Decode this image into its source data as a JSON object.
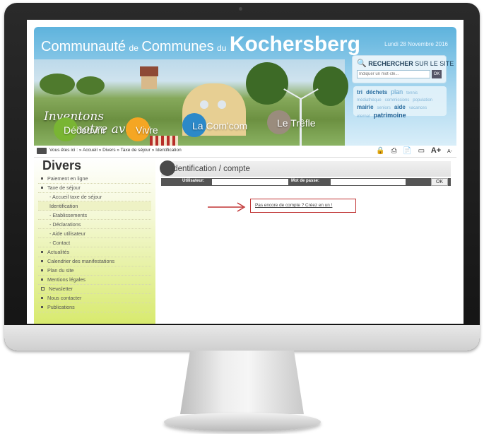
{
  "header": {
    "brand": {
      "part1": "Communauté",
      "de": "de",
      "part2": "Communes",
      "du": "du",
      "name": "Kochersberg"
    },
    "date": "Lundi 28 Novembre 2016",
    "slogan": {
      "line1": "Inventons",
      "line2": "notre avenir"
    },
    "search": {
      "title": "RECHERCHER",
      "subtitle": "SUR LE SITE",
      "placeholder": "Indiquer un mot-clé...",
      "ok": "OK"
    },
    "tags": [
      "tri",
      "déchets",
      "plan",
      "tennis",
      "médiathèque",
      "commissions",
      "population",
      "mairie",
      "seniors",
      "aide",
      "vacances",
      "eternat",
      "patrimoine"
    ],
    "nav": [
      {
        "label": "Découvrir",
        "color": "#79b533"
      },
      {
        "label": "Vivre",
        "color": "#f5a623"
      },
      {
        "label": "La Com'com",
        "color": "#2c89c9"
      },
      {
        "label": "Le Trêfle",
        "color": "#9a8c7d"
      }
    ]
  },
  "breadcrumb": "Vous êtes ici : » Accueil » Divers » Taxe de séjour » Identification",
  "tools": [
    "lock-icon",
    "print-icon",
    "pdf-icon",
    "window-icon",
    "A+",
    "A-"
  ],
  "sidebar": {
    "title": "Divers",
    "items": [
      {
        "label": "Paiement en ligne",
        "type": "bullet"
      },
      {
        "label": "Taxe de séjour",
        "type": "bullet"
      },
      {
        "label": "- Accueil taxe de séjour",
        "type": "sub"
      },
      {
        "label": "Identification",
        "type": "sub-active"
      },
      {
        "label": "- Etablissements",
        "type": "sub"
      },
      {
        "label": "- Déclarations",
        "type": "sub"
      },
      {
        "label": "- Aide utilisateur",
        "type": "sub"
      },
      {
        "label": "- Contact",
        "type": "sub"
      },
      {
        "label": "Actualités",
        "type": "bullet"
      },
      {
        "label": "Calendrier des manifestations",
        "type": "bullet"
      },
      {
        "label": "Plan du site",
        "type": "bullet"
      },
      {
        "label": "Mentions légales",
        "type": "bullet"
      },
      {
        "label": "Newsletter",
        "type": "square"
      },
      {
        "label": "Nous contacter",
        "type": "bullet"
      },
      {
        "label": "Publications",
        "type": "bullet"
      }
    ]
  },
  "main": {
    "title": "Identification / compte",
    "login": {
      "user_label": "Utilisateur:",
      "pass_label": "Mot de passe:",
      "ok": "OK"
    },
    "create_account": "Pas encore de compte ? Créez en un !"
  },
  "colors": {
    "accent_red": "#c03333",
    "sidebar_green": "#d8ea6e",
    "header_blue": "#5eb3dd"
  }
}
